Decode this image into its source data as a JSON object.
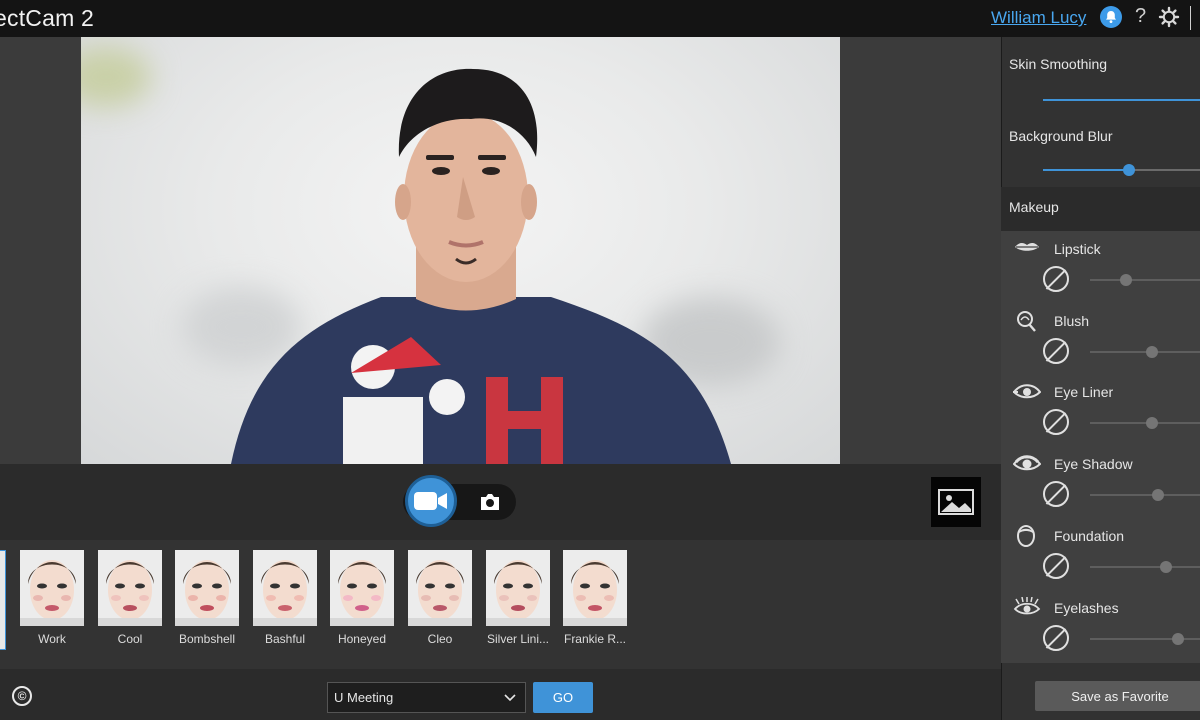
{
  "app": {
    "title": "ectCam 2"
  },
  "header": {
    "user_name": "William Lucy",
    "help_label": "?"
  },
  "capture": {
    "video_icon": "video-camera-icon",
    "photo_icon": "camera-icon",
    "gallery_icon": "image-gallery-icon"
  },
  "presets": [
    {
      "label": "Work",
      "lip": "#c4596a",
      "cheek": "#e9b7b0"
    },
    {
      "label": "Cool",
      "lip": "#b8505f",
      "cheek": "#efc3bd"
    },
    {
      "label": "Bombshell",
      "lip": "#c04e5d",
      "cheek": "#ebb4ab"
    },
    {
      "label": "Bashful",
      "lip": "#c9616c",
      "cheek": "#f0bcb2"
    },
    {
      "label": "Honeyed",
      "lip": "#d0608a",
      "cheek": "#f3b9c6"
    },
    {
      "label": "Cleo",
      "lip": "#b9586a",
      "cheek": "#e7bcb4"
    },
    {
      "label": "Silver Lini...",
      "lip": "#b44d5e",
      "cheek": "#eac2bb"
    },
    {
      "label": "Frankie R...",
      "lip": "#c35465",
      "cheek": "#ecbdb4"
    }
  ],
  "footer": {
    "copyright_symbol": "©",
    "app_select_value": "U Meeting",
    "go_label": "GO"
  },
  "panel": {
    "skin_smoothing_label": "Skin Smoothing",
    "background_blur_label": "Background Blur",
    "background_blur_value": 0.55,
    "makeup_label": "Makeup",
    "makeup_items": [
      {
        "label": "Lipstick",
        "icon": "lips-icon",
        "value": 0.3
      },
      {
        "label": "Blush",
        "icon": "blush-brush-icon",
        "value": 0.52
      },
      {
        "label": "Eye Liner",
        "icon": "eye-liner-icon",
        "value": 0.52
      },
      {
        "label": "Eye Shadow",
        "icon": "eye-shadow-icon",
        "value": 0.57
      },
      {
        "label": "Foundation",
        "icon": "foundation-face-icon",
        "value": 0.63
      },
      {
        "label": "Eyelashes",
        "icon": "eyelashes-icon",
        "value": 0.73
      }
    ],
    "save_favorite_label": "Save as Favorite"
  },
  "colors": {
    "accent": "#3f93d8",
    "link": "#49a7f0",
    "title_bar": "#141414"
  }
}
